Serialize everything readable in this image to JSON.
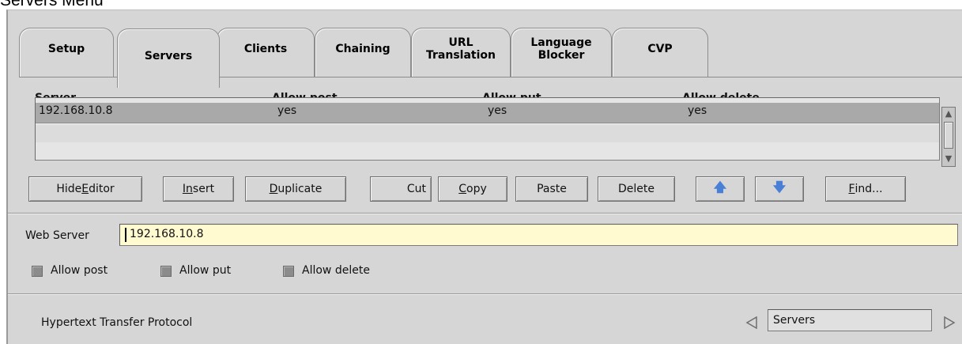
{
  "page": {
    "title": "Servers Menu"
  },
  "tabs": [
    {
      "label": "Setup"
    },
    {
      "label": "Servers"
    },
    {
      "label": "Clients"
    },
    {
      "label": "Chaining"
    },
    {
      "label": "URL\nTranslation"
    },
    {
      "label": "Language\nBlocker"
    },
    {
      "label": "CVP"
    }
  ],
  "active_tab": "Servers",
  "table": {
    "columns": [
      "Server",
      "Allow post",
      "Allow put",
      "Allow delete"
    ],
    "rows": [
      [
        "192.168.10.8",
        "yes",
        "yes",
        "yes"
      ]
    ]
  },
  "toolbar": {
    "hide_editor": {
      "pre": "Hide ",
      "mn": "E",
      "post": "ditor"
    },
    "insert": {
      "pre": "",
      "mn": "In",
      "post": "sert"
    },
    "duplicate": {
      "pre": "",
      "mn": "D",
      "post": "uplicate"
    },
    "cut": "Cut",
    "copy": {
      "pre": "",
      "mn": "C",
      "post": "opy"
    },
    "paste": "Paste",
    "delete": "Delete",
    "move_up_icon": "arrow-up-icon",
    "move_down_icon": "arrow-down-icon",
    "find": {
      "pre": "",
      "mn": "F",
      "post": "ind..."
    }
  },
  "editor": {
    "web_server_label": "Web Server",
    "web_server_value": "192.168.10.8",
    "checkboxes": [
      {
        "label": "Allow post"
      },
      {
        "label": "Allow put"
      },
      {
        "label": "Allow delete"
      }
    ]
  },
  "status": {
    "protocol": "Hypertext Transfer Protocol",
    "menu_selection": "Servers"
  },
  "colors": {
    "panel_bg": "#d6d6d6",
    "input_bg": "#fffad0",
    "selected_row": "#a9a9a9",
    "arrow_icon": "#4a7fd6"
  }
}
